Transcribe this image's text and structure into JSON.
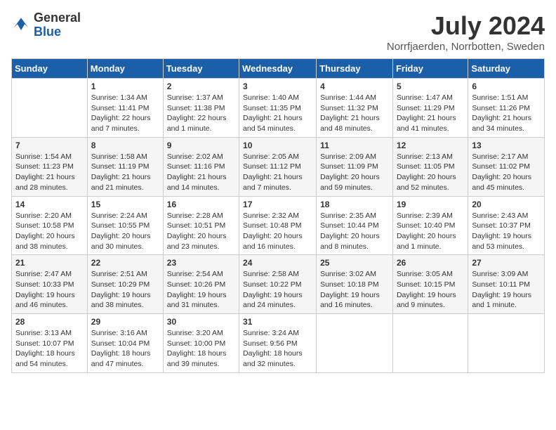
{
  "logo": {
    "general": "General",
    "blue": "Blue"
  },
  "title": "July 2024",
  "location": "Norrfjaerden, Norrbotten, Sweden",
  "days_of_week": [
    "Sunday",
    "Monday",
    "Tuesday",
    "Wednesday",
    "Thursday",
    "Friday",
    "Saturday"
  ],
  "weeks": [
    [
      {
        "day": "",
        "sunrise": "",
        "sunset": "",
        "daylight": ""
      },
      {
        "day": "1",
        "sunrise": "Sunrise: 1:34 AM",
        "sunset": "Sunset: 11:41 PM",
        "daylight": "Daylight: 22 hours and 7 minutes."
      },
      {
        "day": "2",
        "sunrise": "Sunrise: 1:37 AM",
        "sunset": "Sunset: 11:38 PM",
        "daylight": "Daylight: 22 hours and 1 minute."
      },
      {
        "day": "3",
        "sunrise": "Sunrise: 1:40 AM",
        "sunset": "Sunset: 11:35 PM",
        "daylight": "Daylight: 21 hours and 54 minutes."
      },
      {
        "day": "4",
        "sunrise": "Sunrise: 1:44 AM",
        "sunset": "Sunset: 11:32 PM",
        "daylight": "Daylight: 21 hours and 48 minutes."
      },
      {
        "day": "5",
        "sunrise": "Sunrise: 1:47 AM",
        "sunset": "Sunset: 11:29 PM",
        "daylight": "Daylight: 21 hours and 41 minutes."
      },
      {
        "day": "6",
        "sunrise": "Sunrise: 1:51 AM",
        "sunset": "Sunset: 11:26 PM",
        "daylight": "Daylight: 21 hours and 34 minutes."
      }
    ],
    [
      {
        "day": "7",
        "sunrise": "Sunrise: 1:54 AM",
        "sunset": "Sunset: 11:23 PM",
        "daylight": "Daylight: 21 hours and 28 minutes."
      },
      {
        "day": "8",
        "sunrise": "Sunrise: 1:58 AM",
        "sunset": "Sunset: 11:19 PM",
        "daylight": "Daylight: 21 hours and 21 minutes."
      },
      {
        "day": "9",
        "sunrise": "Sunrise: 2:02 AM",
        "sunset": "Sunset: 11:16 PM",
        "daylight": "Daylight: 21 hours and 14 minutes."
      },
      {
        "day": "10",
        "sunrise": "Sunrise: 2:05 AM",
        "sunset": "Sunset: 11:12 PM",
        "daylight": "Daylight: 21 hours and 7 minutes."
      },
      {
        "day": "11",
        "sunrise": "Sunrise: 2:09 AM",
        "sunset": "Sunset: 11:09 PM",
        "daylight": "Daylight: 20 hours and 59 minutes."
      },
      {
        "day": "12",
        "sunrise": "Sunrise: 2:13 AM",
        "sunset": "Sunset: 11:05 PM",
        "daylight": "Daylight: 20 hours and 52 minutes."
      },
      {
        "day": "13",
        "sunrise": "Sunrise: 2:17 AM",
        "sunset": "Sunset: 11:02 PM",
        "daylight": "Daylight: 20 hours and 45 minutes."
      }
    ],
    [
      {
        "day": "14",
        "sunrise": "Sunrise: 2:20 AM",
        "sunset": "Sunset: 10:58 PM",
        "daylight": "Daylight: 20 hours and 38 minutes."
      },
      {
        "day": "15",
        "sunrise": "Sunrise: 2:24 AM",
        "sunset": "Sunset: 10:55 PM",
        "daylight": "Daylight: 20 hours and 30 minutes."
      },
      {
        "day": "16",
        "sunrise": "Sunrise: 2:28 AM",
        "sunset": "Sunset: 10:51 PM",
        "daylight": "Daylight: 20 hours and 23 minutes."
      },
      {
        "day": "17",
        "sunrise": "Sunrise: 2:32 AM",
        "sunset": "Sunset: 10:48 PM",
        "daylight": "Daylight: 20 hours and 16 minutes."
      },
      {
        "day": "18",
        "sunrise": "Sunrise: 2:35 AM",
        "sunset": "Sunset: 10:44 PM",
        "daylight": "Daylight: 20 hours and 8 minutes."
      },
      {
        "day": "19",
        "sunrise": "Sunrise: 2:39 AM",
        "sunset": "Sunset: 10:40 PM",
        "daylight": "Daylight: 20 hours and 1 minute."
      },
      {
        "day": "20",
        "sunrise": "Sunrise: 2:43 AM",
        "sunset": "Sunset: 10:37 PM",
        "daylight": "Daylight: 19 hours and 53 minutes."
      }
    ],
    [
      {
        "day": "21",
        "sunrise": "Sunrise: 2:47 AM",
        "sunset": "Sunset: 10:33 PM",
        "daylight": "Daylight: 19 hours and 46 minutes."
      },
      {
        "day": "22",
        "sunrise": "Sunrise: 2:51 AM",
        "sunset": "Sunset: 10:29 PM",
        "daylight": "Daylight: 19 hours and 38 minutes."
      },
      {
        "day": "23",
        "sunrise": "Sunrise: 2:54 AM",
        "sunset": "Sunset: 10:26 PM",
        "daylight": "Daylight: 19 hours and 31 minutes."
      },
      {
        "day": "24",
        "sunrise": "Sunrise: 2:58 AM",
        "sunset": "Sunset: 10:22 PM",
        "daylight": "Daylight: 19 hours and 24 minutes."
      },
      {
        "day": "25",
        "sunrise": "Sunrise: 3:02 AM",
        "sunset": "Sunset: 10:18 PM",
        "daylight": "Daylight: 19 hours and 16 minutes."
      },
      {
        "day": "26",
        "sunrise": "Sunrise: 3:05 AM",
        "sunset": "Sunset: 10:15 PM",
        "daylight": "Daylight: 19 hours and 9 minutes."
      },
      {
        "day": "27",
        "sunrise": "Sunrise: 3:09 AM",
        "sunset": "Sunset: 10:11 PM",
        "daylight": "Daylight: 19 hours and 1 minute."
      }
    ],
    [
      {
        "day": "28",
        "sunrise": "Sunrise: 3:13 AM",
        "sunset": "Sunset: 10:07 PM",
        "daylight": "Daylight: 18 hours and 54 minutes."
      },
      {
        "day": "29",
        "sunrise": "Sunrise: 3:16 AM",
        "sunset": "Sunset: 10:04 PM",
        "daylight": "Daylight: 18 hours and 47 minutes."
      },
      {
        "day": "30",
        "sunrise": "Sunrise: 3:20 AM",
        "sunset": "Sunset: 10:00 PM",
        "daylight": "Daylight: 18 hours and 39 minutes."
      },
      {
        "day": "31",
        "sunrise": "Sunrise: 3:24 AM",
        "sunset": "Sunset: 9:56 PM",
        "daylight": "Daylight: 18 hours and 32 minutes."
      },
      {
        "day": "",
        "sunrise": "",
        "sunset": "",
        "daylight": ""
      },
      {
        "day": "",
        "sunrise": "",
        "sunset": "",
        "daylight": ""
      },
      {
        "day": "",
        "sunrise": "",
        "sunset": "",
        "daylight": ""
      }
    ]
  ]
}
